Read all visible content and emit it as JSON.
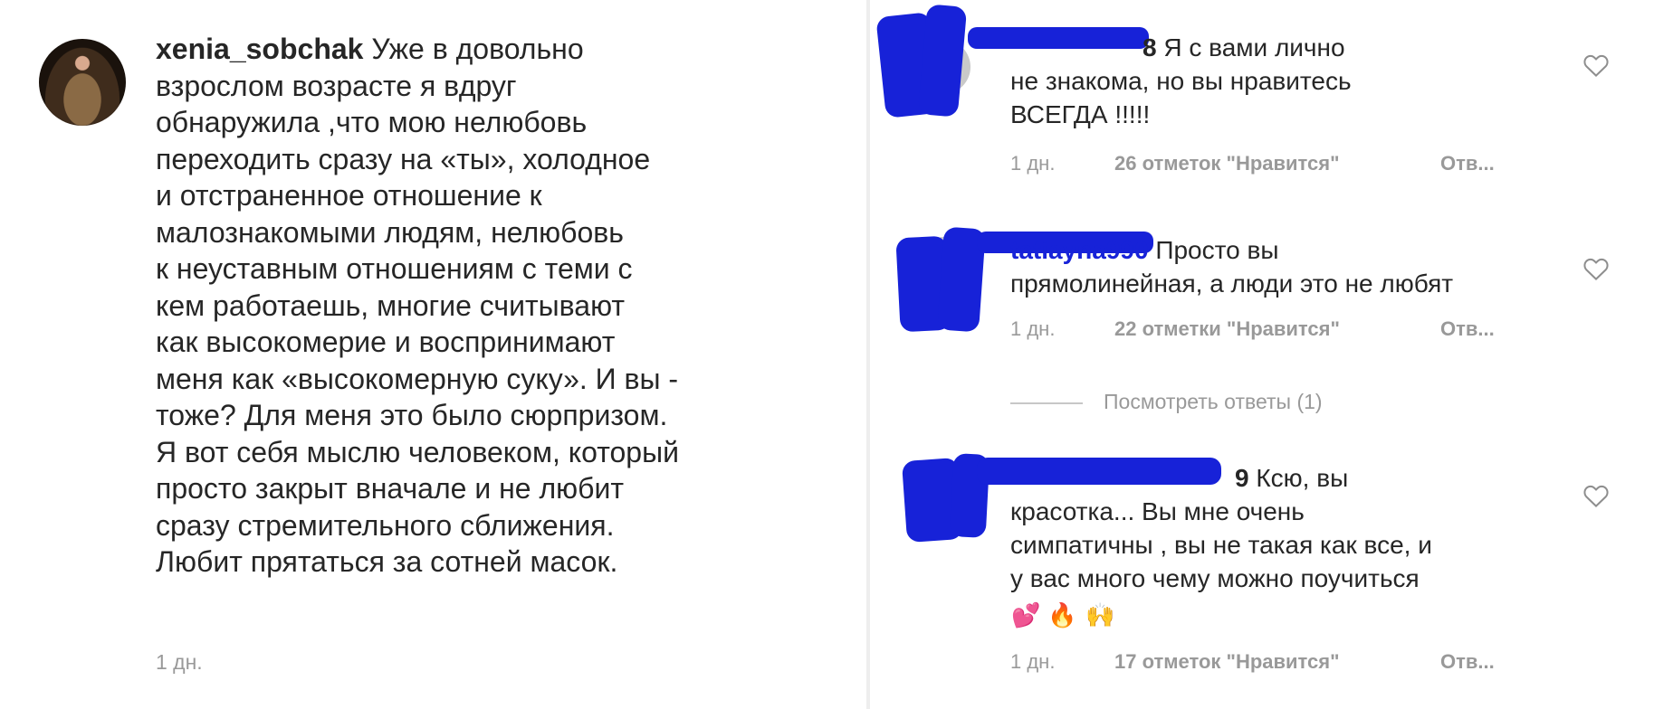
{
  "post": {
    "username": "xenia_sobchak",
    "caption_lines": [
      "Уже в довольно",
      "взрослом возрасте я вдруг",
      "обнаружила ,что мою нелюбовь",
      "переходить сразу на «ты», холодное",
      "и отстраненное отношение к",
      "малознакомыми людям, нелюбовь",
      "к неуставным отношениям с теми с",
      "кем работаешь, многие считывают",
      "как высокомерие и воспринимают",
      "меня как «высокомерную суку». И вы -",
      "тоже?  Для меня это было сюрпризом.",
      "Я вот себя мыслю человеком, который",
      "просто закрыт вначале и не любит",
      "сразу стремительного сближения.",
      "Любит прятаться за сотней масок."
    ],
    "time": "1 дн."
  },
  "comments": [
    {
      "username_visible": "8",
      "text_lines": [
        "Я с вами лично",
        "не знакома, но вы нравитесь",
        "ВСЕГДА !!!!!"
      ],
      "time": "1 дн.",
      "likes": "26 отметок \"Нравится\"",
      "reply": "Отв..."
    },
    {
      "username_visible": "tatiayna990",
      "text_lines": [
        "Просто вы",
        "прямолинейная, а люди это не любят"
      ],
      "time": "1 дн.",
      "likes": "22 отметки \"Нравится\"",
      "reply": "Отв..."
    },
    {
      "username_visible": "9",
      "text_lines": [
        "Ксю, вы",
        "красотка... Вы мне очень",
        "симпатичны , вы не такая как все, и",
        "у вас много чему можно поучиться"
      ],
      "emojis": [
        "💕",
        "🔥",
        "🙌"
      ],
      "time": "1 дн.",
      "likes": "17 отметок \"Нравится\"",
      "reply": "Отв..."
    }
  ],
  "view_replies": "Посмотреть ответы (1)",
  "icons": {
    "like": "heart-outline-icon",
    "redaction": "blue-marker-redaction"
  },
  "colors": {
    "text": "#262626",
    "muted": "#999999",
    "redaction": "#1722d8",
    "divider": "#eeeeee"
  }
}
